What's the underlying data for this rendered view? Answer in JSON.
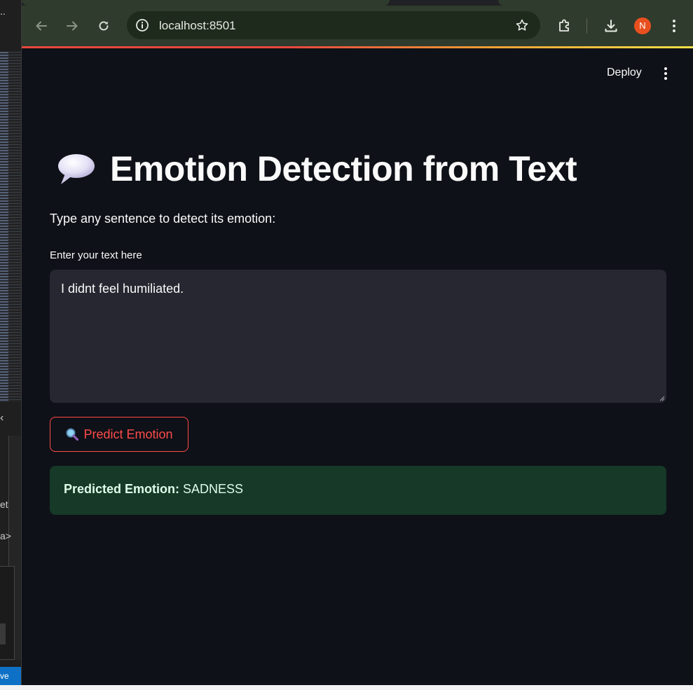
{
  "background_window": {
    "title_fragment": "..",
    "text_fragment_1": "et",
    "text_fragment_2": "a>",
    "status_fragment": "ve"
  },
  "browser": {
    "url": "localhost:8501",
    "profile_initial": "N",
    "accent_colors": [
      "#e8483e",
      "#f0a034",
      "#f7e04a"
    ]
  },
  "header": {
    "deploy_label": "Deploy"
  },
  "main": {
    "title_icon": "speech-balloon-icon",
    "title": "Emotion Detection from Text",
    "subtitle": "Type any sentence to detect its emotion:",
    "input_label": "Enter your text here",
    "input_value": "I didnt feel humiliated.",
    "button_icon": "magnifying-glass-icon",
    "button_label": "Predict Emotion",
    "result_label": "Predicted Emotion:",
    "result_value": "SADNESS"
  },
  "colors": {
    "app_background": "#0e1117",
    "primary": "#ff4b4b",
    "success_background": "#173928",
    "input_background": "#262730"
  }
}
